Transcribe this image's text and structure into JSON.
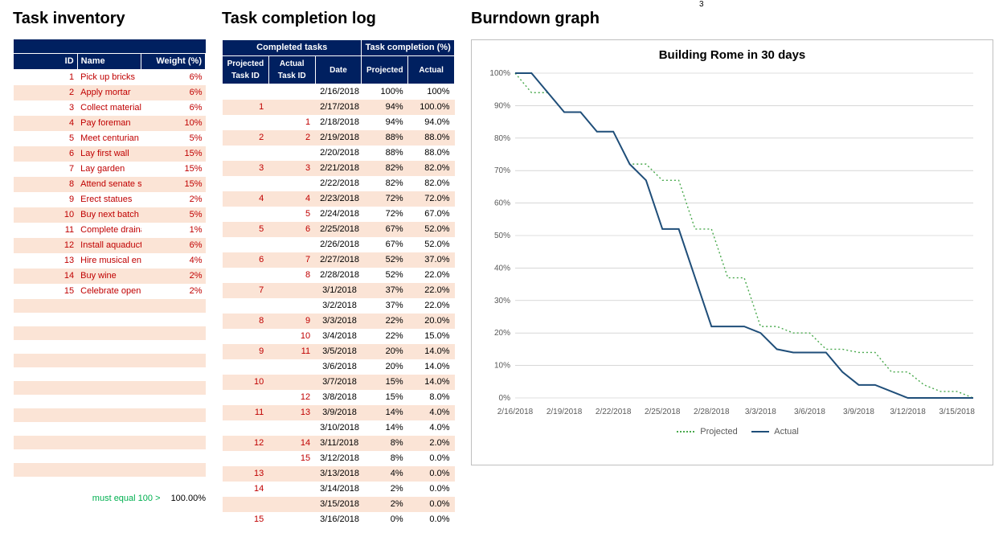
{
  "misc": {
    "stray_digit": "3"
  },
  "headings": {
    "inventory": "Task inventory",
    "log": "Task completion log",
    "chart": "Burndown graph"
  },
  "inventory": {
    "headers": {
      "id": "ID",
      "name": "Name",
      "weight": "Weight (%)"
    },
    "rows": [
      {
        "id": 1,
        "name": "Pick up bricks",
        "weight": "6%"
      },
      {
        "id": 2,
        "name": "Apply mortar",
        "weight": "6%"
      },
      {
        "id": 3,
        "name": "Collect materials",
        "weight": "6%"
      },
      {
        "id": 4,
        "name": "Pay foreman",
        "weight": "10%"
      },
      {
        "id": 5,
        "name": "Meet centurian",
        "weight": "5%"
      },
      {
        "id": 6,
        "name": "Lay first wall",
        "weight": "15%"
      },
      {
        "id": 7,
        "name": "Lay garden",
        "weight": "15%"
      },
      {
        "id": 8,
        "name": "Attend senate session",
        "weight": "15%"
      },
      {
        "id": 9,
        "name": "Erect statues",
        "weight": "2%"
      },
      {
        "id": 10,
        "name": "Buy next batch of bricks",
        "weight": "5%"
      },
      {
        "id": 11,
        "name": "Complete drainage",
        "weight": "1%"
      },
      {
        "id": 12,
        "name": "Install aquaduct",
        "weight": "6%"
      },
      {
        "id": 13,
        "name": "Hire musical entertainme",
        "weight": "4%"
      },
      {
        "id": 14,
        "name": "Buy wine",
        "weight": "2%"
      },
      {
        "id": 15,
        "name": "Celebrate opening",
        "weight": "2%"
      }
    ],
    "blank_rows": 14,
    "footer_label": "must equal 100 >",
    "footer_value": "100.00%"
  },
  "log": {
    "group_headers": {
      "left": "Completed tasks",
      "right": "Task completion (%)"
    },
    "sub_headers": {
      "proj_id": "Projected\nTask ID",
      "act_id": "Actual\nTask ID",
      "date": "Date",
      "proj": "Projected",
      "act": "Actual"
    },
    "rows": [
      {
        "proj_id": "",
        "act_id": "",
        "date": "2/16/2018",
        "proj": "100%",
        "act": "100%"
      },
      {
        "proj_id": "1",
        "act_id": "",
        "date": "2/17/2018",
        "proj": "94%",
        "act": "100.0%"
      },
      {
        "proj_id": "",
        "act_id": "1",
        "date": "2/18/2018",
        "proj": "94%",
        "act": "94.0%"
      },
      {
        "proj_id": "2",
        "act_id": "2",
        "date": "2/19/2018",
        "proj": "88%",
        "act": "88.0%"
      },
      {
        "proj_id": "",
        "act_id": "",
        "date": "2/20/2018",
        "proj": "88%",
        "act": "88.0%"
      },
      {
        "proj_id": "3",
        "act_id": "3",
        "date": "2/21/2018",
        "proj": "82%",
        "act": "82.0%"
      },
      {
        "proj_id": "",
        "act_id": "",
        "date": "2/22/2018",
        "proj": "82%",
        "act": "82.0%"
      },
      {
        "proj_id": "4",
        "act_id": "4",
        "date": "2/23/2018",
        "proj": "72%",
        "act": "72.0%"
      },
      {
        "proj_id": "",
        "act_id": "5",
        "date": "2/24/2018",
        "proj": "72%",
        "act": "67.0%"
      },
      {
        "proj_id": "5",
        "act_id": "6",
        "date": "2/25/2018",
        "proj": "67%",
        "act": "52.0%"
      },
      {
        "proj_id": "",
        "act_id": "",
        "date": "2/26/2018",
        "proj": "67%",
        "act": "52.0%"
      },
      {
        "proj_id": "6",
        "act_id": "7",
        "date": "2/27/2018",
        "proj": "52%",
        "act": "37.0%"
      },
      {
        "proj_id": "",
        "act_id": "8",
        "date": "2/28/2018",
        "proj": "52%",
        "act": "22.0%"
      },
      {
        "proj_id": "7",
        "act_id": "",
        "date": "3/1/2018",
        "proj": "37%",
        "act": "22.0%"
      },
      {
        "proj_id": "",
        "act_id": "",
        "date": "3/2/2018",
        "proj": "37%",
        "act": "22.0%"
      },
      {
        "proj_id": "8",
        "act_id": "9",
        "date": "3/3/2018",
        "proj": "22%",
        "act": "20.0%"
      },
      {
        "proj_id": "",
        "act_id": "10",
        "date": "3/4/2018",
        "proj": "22%",
        "act": "15.0%"
      },
      {
        "proj_id": "9",
        "act_id": "11",
        "date": "3/5/2018",
        "proj": "20%",
        "act": "14.0%"
      },
      {
        "proj_id": "",
        "act_id": "",
        "date": "3/6/2018",
        "proj": "20%",
        "act": "14.0%"
      },
      {
        "proj_id": "10",
        "act_id": "",
        "date": "3/7/2018",
        "proj": "15%",
        "act": "14.0%"
      },
      {
        "proj_id": "",
        "act_id": "12",
        "date": "3/8/2018",
        "proj": "15%",
        "act": "8.0%"
      },
      {
        "proj_id": "11",
        "act_id": "13",
        "date": "3/9/2018",
        "proj": "14%",
        "act": "4.0%"
      },
      {
        "proj_id": "",
        "act_id": "",
        "date": "3/10/2018",
        "proj": "14%",
        "act": "4.0%"
      },
      {
        "proj_id": "12",
        "act_id": "14",
        "date": "3/11/2018",
        "proj": "8%",
        "act": "2.0%"
      },
      {
        "proj_id": "",
        "act_id": "15",
        "date": "3/12/2018",
        "proj": "8%",
        "act": "0.0%"
      },
      {
        "proj_id": "13",
        "act_id": "",
        "date": "3/13/2018",
        "proj": "4%",
        "act": "0.0%"
      },
      {
        "proj_id": "14",
        "act_id": "",
        "date": "3/14/2018",
        "proj": "2%",
        "act": "0.0%"
      },
      {
        "proj_id": "",
        "act_id": "",
        "date": "3/15/2018",
        "proj": "2%",
        "act": "0.0%"
      },
      {
        "proj_id": "15",
        "act_id": "",
        "date": "3/16/2018",
        "proj": "0%",
        "act": "0.0%"
      }
    ]
  },
  "chart_data": {
    "type": "line",
    "title": "Building Rome in 30 days",
    "xlabel": "",
    "ylabel": "",
    "ylim": [
      0,
      100
    ],
    "y_ticks": [
      0,
      10,
      20,
      30,
      40,
      50,
      60,
      70,
      80,
      90,
      100
    ],
    "y_tick_labels": [
      "0%",
      "10%",
      "20%",
      "30%",
      "40%",
      "50%",
      "60%",
      "70%",
      "80%",
      "90%",
      "100%"
    ],
    "x": [
      "2/16/2018",
      "2/17/2018",
      "2/18/2018",
      "2/19/2018",
      "2/20/2018",
      "2/21/2018",
      "2/22/2018",
      "2/23/2018",
      "2/24/2018",
      "2/25/2018",
      "2/26/2018",
      "2/27/2018",
      "2/28/2018",
      "3/1/2018",
      "3/2/2018",
      "3/3/2018",
      "3/4/2018",
      "3/5/2018",
      "3/6/2018",
      "3/7/2018",
      "3/8/2018",
      "3/9/2018",
      "3/10/2018",
      "3/11/2018",
      "3/12/2018",
      "3/13/2018",
      "3/14/2018",
      "3/15/2018",
      "3/16/2018"
    ],
    "x_tick_labels": [
      "2/16/2018",
      "2/19/2018",
      "2/22/2018",
      "2/25/2018",
      "2/28/2018",
      "3/3/2018",
      "3/6/2018",
      "3/9/2018",
      "3/12/2018",
      "3/15/2018"
    ],
    "series": [
      {
        "name": "Projected",
        "style": "dotted",
        "color": "#49a94d",
        "values": [
          100,
          94,
          94,
          88,
          88,
          82,
          82,
          72,
          72,
          67,
          67,
          52,
          52,
          37,
          37,
          22,
          22,
          20,
          20,
          15,
          15,
          14,
          14,
          8,
          8,
          4,
          2,
          2,
          0
        ]
      },
      {
        "name": "Actual",
        "style": "solid",
        "color": "#1f4e79",
        "values": [
          100,
          100,
          94,
          88,
          88,
          82,
          82,
          72,
          67,
          52,
          52,
          37,
          22,
          22,
          22,
          20,
          15,
          14,
          14,
          14,
          8,
          4,
          4,
          2,
          0,
          0,
          0,
          0,
          0
        ]
      }
    ],
    "legend": [
      "Projected",
      "Actual"
    ]
  }
}
